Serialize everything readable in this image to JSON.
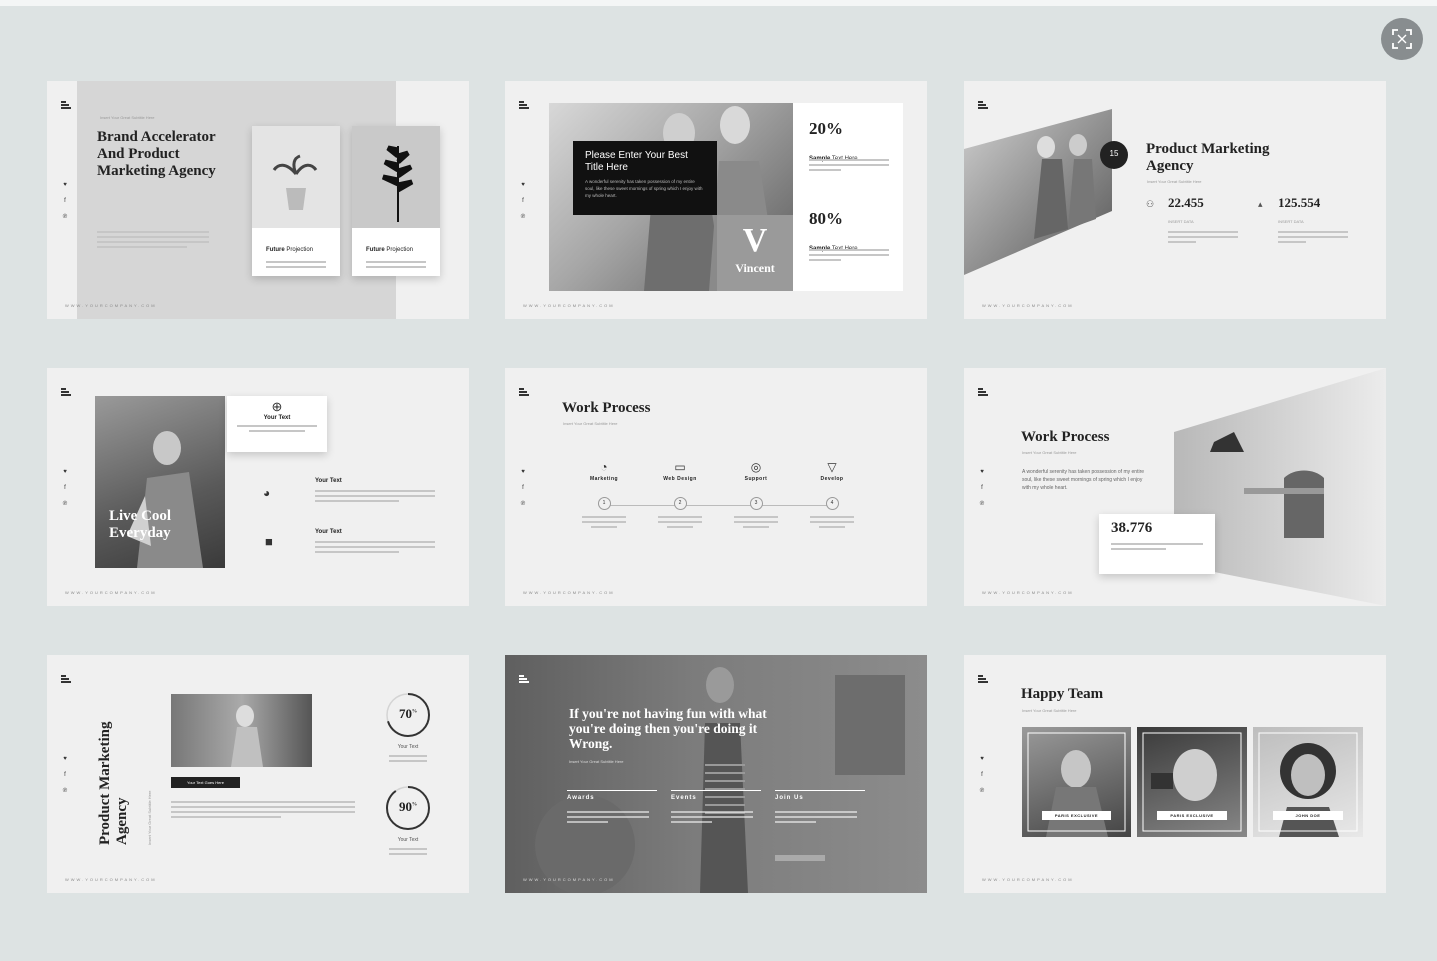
{
  "expand_icon": "fullscreen-icon",
  "colors": {
    "background": "#dde3e3",
    "slide": "#f0f0f0",
    "dark_box": "#111111",
    "accent_gray": "#9a9a9a"
  },
  "social_icons": [
    "twitter-icon",
    "facebook-icon",
    "pinterest-icon"
  ],
  "footer_text": "WWW.YOURCOMPANY.COM",
  "subtitle_small": "Insert Your Great Subtitle Here",
  "slides": {
    "s1": {
      "title": "Brand Accelerator And Product Marketing Agency",
      "card1_label_bold": "Future",
      "card1_label": " Projection",
      "card2_label_bold": "Future",
      "card2_label": " Projection"
    },
    "s2": {
      "box_title": "Please Enter Your Best Title Here",
      "box_text": "A wonderful serenity has taken possession of my entire soul, like these sweet mornings of spring which I enjoy with my whole heart.",
      "brand_letter": "V",
      "brand_name": "Vincent",
      "stat1": "20%",
      "stat2": "80%",
      "stat_label_bold": "Sample",
      "stat_label": " Text Here"
    },
    "s3": {
      "title": "Product Marketing Agency",
      "badge_number": "15",
      "stat1": "22.455",
      "stat2": "125.554",
      "stat_caption": "INSERT DATA"
    },
    "s4": {
      "overlay_text": "Live Cool Everyday",
      "card_label": "Your Text",
      "item1_label": "Your Text",
      "item2_label": "Your Text"
    },
    "s5": {
      "title": "Work Process",
      "steps": [
        {
          "label": "Marketing",
          "num": "1"
        },
        {
          "label": "Web Design",
          "num": "2"
        },
        {
          "label": "Support",
          "num": "3"
        },
        {
          "label": "Develop",
          "num": "4"
        }
      ]
    },
    "s6": {
      "title": "Work Process",
      "body": "A wonderful serenity has taken possession of my entire soul, like these sweet mornings of spring which I enjoy with my whole heart.",
      "stat": "38.776"
    },
    "s7": {
      "title": "Product Marketing Agency",
      "button_label": "Your Text Goes Here",
      "ring1": "70",
      "ring2": "90",
      "ring1_value": 0.7,
      "ring2_value": 0.9,
      "ring_unit": "%",
      "ring_label": "Your Text"
    },
    "s8": {
      "quote": "If you're not having fun with what you're doing then you're doing it Wrong.",
      "col1": "Awards",
      "col2": "Events",
      "col3": "Join Us"
    },
    "s9": {
      "title": "Happy Team",
      "member1": "PARIS EXCLUSIVE",
      "member2": "PARIS EXCLUSIVE",
      "member3": "JOHN DOE"
    }
  }
}
